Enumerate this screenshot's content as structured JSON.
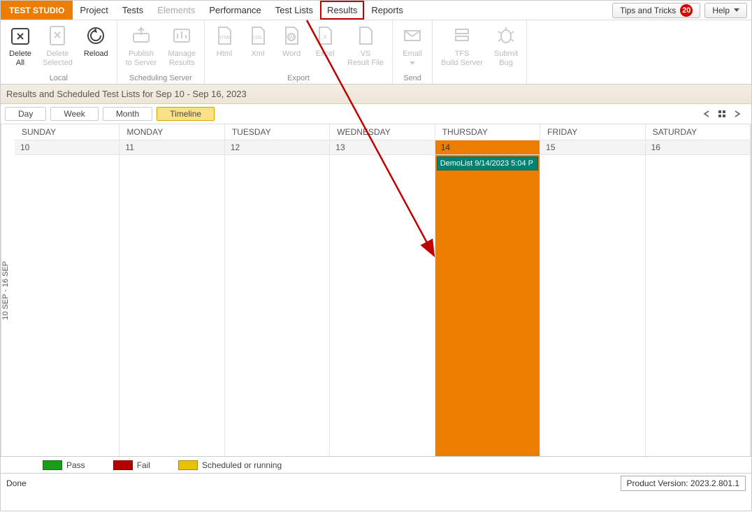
{
  "app": {
    "brand": "TEST STUDIO",
    "menu": {
      "project": "Project",
      "tests": "Tests",
      "elements": "Elements",
      "performance": "Performance",
      "test_lists": "Test Lists",
      "results": "Results",
      "reports": "Reports"
    },
    "tips_label": "Tips and Tricks",
    "tips_count": "20",
    "help_label": "Help"
  },
  "ribbon": {
    "delete_all": "Delete\nAll",
    "delete_selected": "Delete\nSelected",
    "reload": "Reload",
    "local_caption": "Local",
    "publish": "Publish\nto Server",
    "manage_results": "Manage\nResults",
    "scheduling_caption": "Scheduling Server",
    "html": "Html",
    "xml": "Xml",
    "word": "Word",
    "excel": "Excel",
    "vs_result": "VS\nResult File",
    "export_caption": "Export",
    "email": "Email",
    "send_caption": "Send",
    "tfs": "TFS\nBuild Server",
    "submit_bug": "Submit\nBug"
  },
  "subheader": "Results and Scheduled Test Lists for Sep 10 - Sep 16, 2023",
  "views": {
    "day": "Day",
    "week": "Week",
    "month": "Month",
    "timeline": "Timeline"
  },
  "calendar": {
    "range_label": "10 SEP - 16 SEP",
    "days": [
      "SUNDAY",
      "MONDAY",
      "TUESDAY",
      "WEDNESDAY",
      "THURSDAY",
      "FRIDAY",
      "SATURDAY"
    ],
    "dates": [
      "10",
      "11",
      "12",
      "13",
      "14",
      "15",
      "16"
    ],
    "current_index": 4,
    "event_label": "DemoList 9/14/2023 5:04 P"
  },
  "legend": {
    "pass": "Pass",
    "fail": "Fail",
    "scheduled": "Scheduled or running",
    "colors": {
      "pass": "#1a9e1a",
      "fail": "#b60000",
      "scheduled": "#e8c400"
    }
  },
  "status": {
    "left": "Done",
    "version": "Product Version: 2023.2.801.1"
  }
}
